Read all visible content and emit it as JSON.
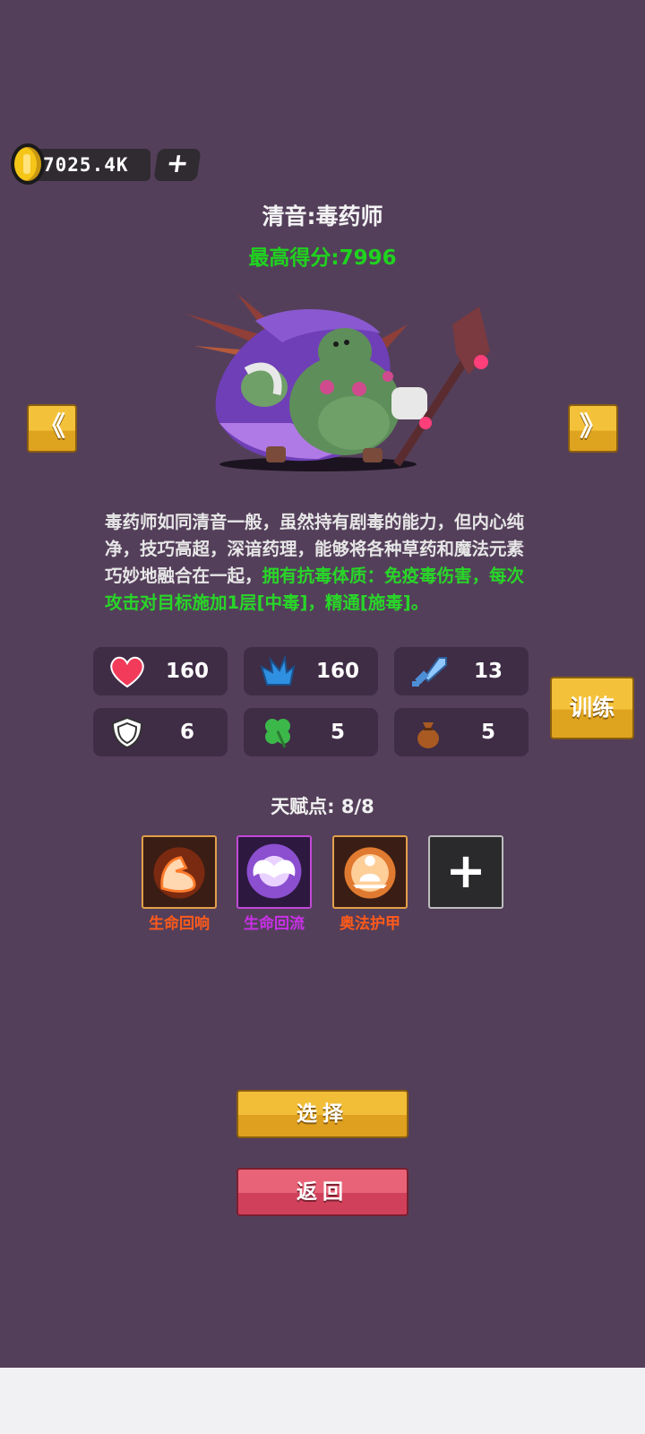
{
  "currency": {
    "amount": "7025.4K",
    "add_label": "+",
    "icon": "gold-coin-icon"
  },
  "character": {
    "name": "清音:毒药师",
    "best_score": "最高得分:7996",
    "description_plain": "毒药师如同清音一般，虽然持有剧毒的能力，但内心纯净，技巧高超，深谙药理，能够将各种草药和魔法元素巧妙地融合在一起，",
    "description_highlight": "拥有抗毒体质：免疫毒伤害，每次攻击对目标施加1层[中毒]，精通[施毒]。"
  },
  "nav": {
    "prev_label": "《",
    "next_label": "》"
  },
  "stats": [
    {
      "icon": "heart-icon",
      "value": "160",
      "color": "#f23b5a"
    },
    {
      "icon": "blue-flame-icon",
      "value": "160",
      "color": "#2f8fe0"
    },
    {
      "icon": "sword-icon",
      "value": "13",
      "color": "#8fc7ff"
    },
    {
      "icon": "shield-icon",
      "value": "6",
      "color": "#ffffff"
    },
    {
      "icon": "clover-icon",
      "value": "5",
      "color": "#3cb84a"
    },
    {
      "icon": "money-bag-icon",
      "value": "5",
      "color": "#a85a22"
    }
  ],
  "train_label": "训练",
  "talents": {
    "points": "天赋点: 8/8",
    "skills": [
      {
        "name": "生命回响",
        "icon": "flexed-arm-icon",
        "label_color": "#ff5a1a"
      },
      {
        "name": "生命回流",
        "icon": "angel-wings-icon",
        "label_color": "#c930e8"
      },
      {
        "name": "奥法护甲",
        "icon": "meditation-icon",
        "label_color": "#ff5a1a"
      }
    ],
    "add_label": "+"
  },
  "buttons": {
    "select": "选择",
    "back": "返回"
  }
}
